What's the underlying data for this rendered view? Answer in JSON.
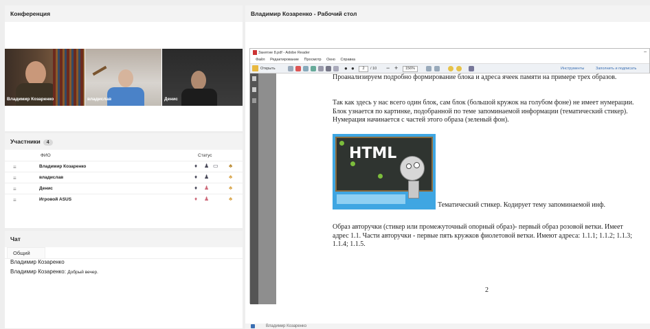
{
  "conference": {
    "title": "Конференция",
    "videos": [
      {
        "name": "Владимир Козаренко"
      },
      {
        "name": "владислав"
      },
      {
        "name": "Денис"
      }
    ]
  },
  "participants": {
    "title": "Участники",
    "count": "4",
    "col_name": "ФИО",
    "col_status": "Статус",
    "rows": [
      {
        "name": "Владимир Козаренко"
      },
      {
        "name": "владислав"
      },
      {
        "name": "Денис"
      },
      {
        "name": "Игровой ASUS"
      }
    ]
  },
  "chat": {
    "title": "Чат",
    "tab": "Общий",
    "messages": [
      {
        "text": "Владимир Козаренко"
      },
      {
        "author": "Владимир Козаренко:",
        "text": "Добрый вечер."
      }
    ]
  },
  "desktop": {
    "title": "Владимир Козаренко - Рабочий стол",
    "reader": {
      "window_title": "Занятие 8.pdf - Adobe Reader",
      "menu": [
        "Файл",
        "Редактирование",
        "Просмотр",
        "Окно",
        "Справка"
      ],
      "open_label": "Открыть",
      "page_current": "2",
      "page_total": "/ 10",
      "zoom": "156%",
      "tools_label": "Инструменты",
      "fill_sign_label": "Заполнить и подписать",
      "paragraph1": "Проанализируем подробно формирование блока и адреса ячеек памяти на примере трех образов.",
      "paragraph2": "Так как здесь у нас всего один блок, сам блок (большой кружок на голубом фоне) не имеет нумерации. Блок узнается по картинке, подобранной по теме запоминаемой информации (тематический стикер). Нумерация начинается с частей этого образа (зеленый фон).",
      "sticker_text": "HTML",
      "caption": "Тематический стикер. Кодирует тему запоминаемой инф.",
      "paragraph3": "Образ авторучки (стикер или промежуточный опорный образ)- первый образ розовой ветки. Имеет адрес 1.1. Части авторучки - первые пять кружков фиолетовой ветки. Имеют адреса: 1.1.1; 1.1.2; 1.1.3; 1.1.4; 1.1.5.",
      "page_number": "2"
    },
    "bottom_label": "Владимир Козаренко"
  }
}
